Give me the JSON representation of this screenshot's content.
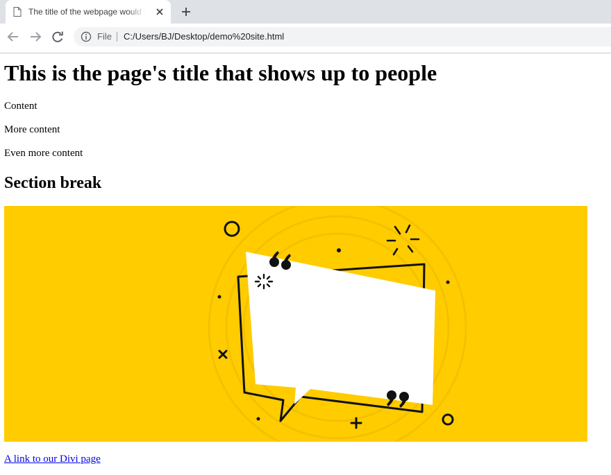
{
  "browser": {
    "tab": {
      "title": "The title of the webpage would go here",
      "favicon": "page-icon"
    },
    "address_bar": {
      "scheme_label": "File",
      "url": "C:/Users/BJ/Desktop/demo%20site.html"
    },
    "icons": [
      "page-icon",
      "close-icon",
      "plus-icon",
      "back-arrow-icon",
      "forward-arrow-icon",
      "reload-icon",
      "info-icon"
    ]
  },
  "page": {
    "title": "This is the page's title that shows up to people",
    "paragraphs": [
      "Content",
      "More content",
      "Even more content"
    ],
    "section_heading": "Section break",
    "banner": {
      "background": "#ffcc00",
      "graphic": "speech-bubble-quote-illustration"
    },
    "link": "A link to our Divi page"
  },
  "colors": {
    "tab_strip": "#dee1e6",
    "omnibox": "#f1f3f4",
    "link": "#0000ee",
    "banner": "#ffcc00"
  }
}
